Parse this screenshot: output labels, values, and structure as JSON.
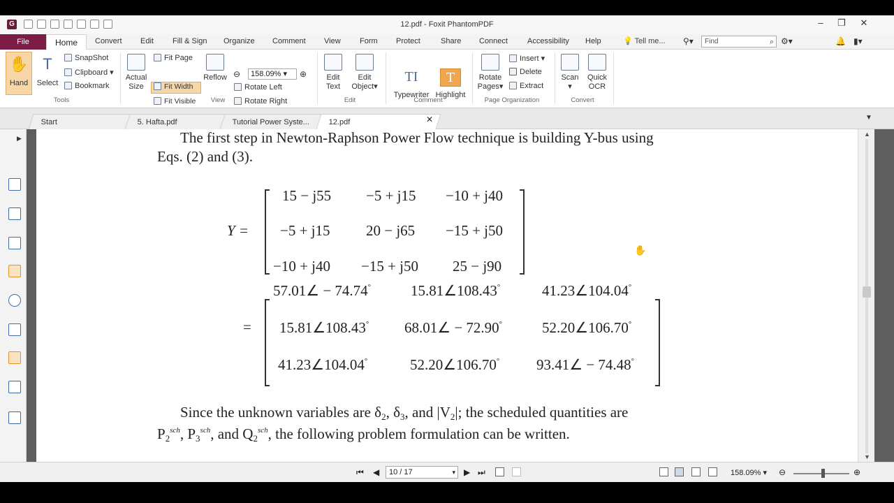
{
  "window": {
    "title": "12.pdf - Foxit PhantomPDF",
    "minimize": "–",
    "restore": "❐",
    "close": "✕"
  },
  "menu": {
    "file": "File",
    "tabs": [
      "Home",
      "Convert",
      "Edit",
      "Fill & Sign",
      "Organize",
      "Comment",
      "View",
      "Form",
      "Protect",
      "Share",
      "Connect",
      "Accessibility",
      "Help"
    ],
    "tellme": "Tell me...",
    "find_placeholder": "Find"
  },
  "ribbon": {
    "hand": "Hand",
    "select": "Select",
    "snapshot": "SnapShot",
    "clipboard": "Clipboard ▾",
    "bookmark": "Bookmark",
    "tools_group": "Tools",
    "actual_size_1": "Actual",
    "actual_size_2": "Size",
    "fit_page": "Fit Page",
    "fit_width": "Fit Width",
    "fit_visible": "Fit Visible",
    "reflow": "Reflow",
    "zoom_value": "158.09%",
    "rotate_left": "Rotate Left",
    "rotate_right": "Rotate Right",
    "view_group": "View",
    "edit_text_1": "Edit",
    "edit_text_2": "Text",
    "edit_object_1": "Edit",
    "edit_object_2": "Object▾",
    "edit_group": "Edit",
    "typewriter": "Typewriter",
    "highlight": "Highlight",
    "comment_group": "Comment",
    "rotate_pages_1": "Rotate",
    "rotate_pages_2": "Pages▾",
    "insert": "Insert ▾",
    "delete": "Delete",
    "extract": "Extract",
    "page_org_group": "Page Organization",
    "scan": "Scan",
    "quick_ocr_1": "Quick",
    "quick_ocr_2": "OCR",
    "convert_group": "Convert"
  },
  "doc_tabs": [
    "Start",
    "5. Hafta.pdf",
    "Tutorial Power Syste...",
    "12.pdf"
  ],
  "document": {
    "line1": "The first step in Newton-Raphson Power Flow technique is building Y-bus using",
    "line2": "Eqs. (2) and (3).",
    "y_label": "Y =",
    "rect_matrix": [
      [
        "15 − j55",
        "−5 + j15",
        "−10 + j40"
      ],
      [
        "−5 + j15",
        "20 − j65",
        "−15 + j50"
      ],
      [
        "−10 + j40",
        "−15 + j50",
        "25 − j90"
      ]
    ],
    "equals": "=",
    "polar_matrix": [
      [
        "57.01∠ − 74.74",
        "15.81∠108.43",
        "41.23∠104.04"
      ],
      [
        "15.81∠108.43",
        "68.01∠ − 72.90",
        "52.20∠106.70"
      ],
      [
        "41.23∠104.04",
        "52.20∠106.70",
        "93.41∠ − 74.48"
      ]
    ],
    "degree": "°",
    "para_a": "Since the unknown variables are δ",
    "sub2": "2",
    "sub3": "3",
    "comma": ", δ",
    "and_v": ", and |V",
    "para_b": "|; the scheduled quantities are",
    "P": "P",
    "sch": "sch",
    "comma_P": ", P",
    "and_Q": ", and Q",
    "para_c": ", the following problem formulation can be written."
  },
  "status": {
    "page_indicator": "10 / 17",
    "zoom": "158.09%"
  }
}
